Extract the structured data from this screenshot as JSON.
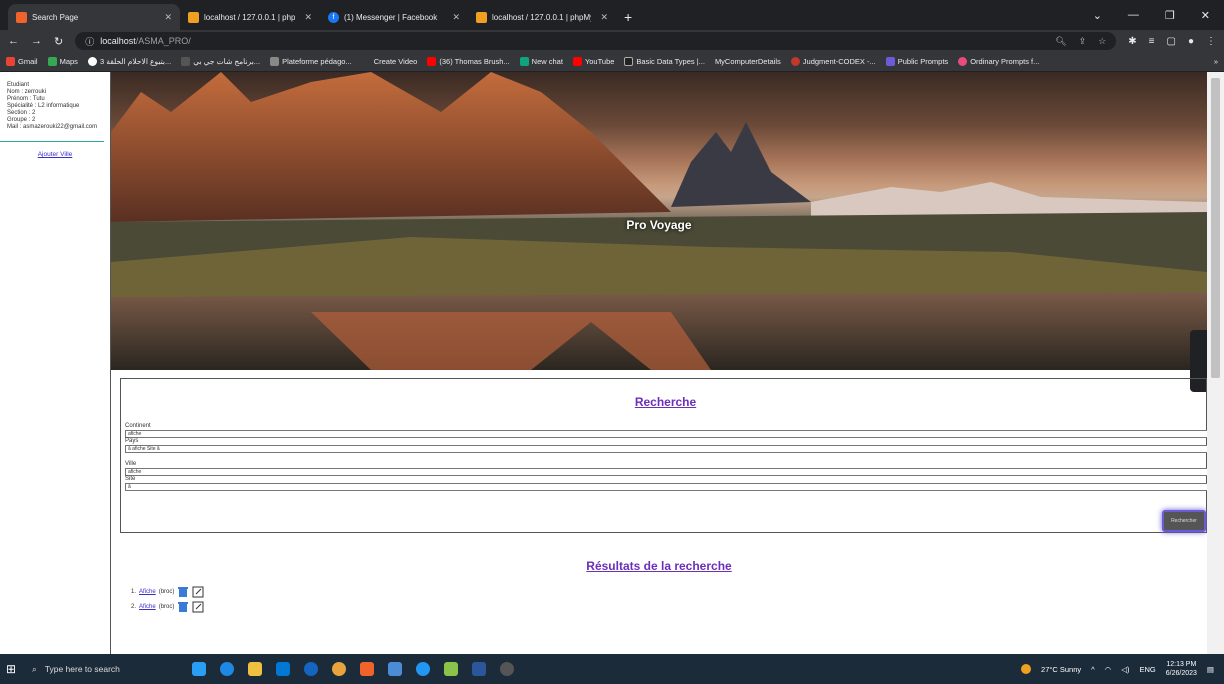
{
  "tabs": [
    {
      "title": "Search Page",
      "icon": "page-icon",
      "color": "#f0642c",
      "active": true
    },
    {
      "title": "localhost / 127.0.0.1 | phpMyAdm",
      "icon": "phpmyadmin-icon",
      "color": "#f0a020"
    },
    {
      "title": "(1) Messenger | Facebook",
      "icon": "facebook-icon",
      "color": "#1877f2"
    },
    {
      "title": "localhost / 127.0.0.1 | phpMyAdm",
      "icon": "phpmyadmin-icon",
      "color": "#f0a020"
    }
  ],
  "address": {
    "host": "localhost",
    "path": "/ASMA_PRO/"
  },
  "bookmarks": [
    "Gmail",
    "Maps",
    "بتبوع الاحلام الحلقة 3...",
    "برنامج شات جي بي...",
    "Plateforme pédago...",
    "Create Video",
    "(36) Thomas Brush...",
    "New chat",
    "YouTube",
    "Basic Data Types |...",
    "MyComputerDetails",
    "Judgment-CODEX -...",
    "Public Prompts",
    "Ordinary Prompts f..."
  ],
  "sidebar": {
    "lines": [
      "Etudiant",
      "Nom : zerrouki",
      "Prénom : Tutu",
      "Spécialité : L2 informatique",
      "Section : 2",
      "Groupe : 2",
      "Mail : asmazerouki22@gmail.com"
    ],
    "link": "Ajouter Ville"
  },
  "hero": {
    "title": "Pro Voyage"
  },
  "form": {
    "title": "Recherche",
    "continent_label": "Continent",
    "continent_value": "afiche",
    "pays_label": "Pays",
    "pays_value": "â afiche Site â",
    "ville_label": "Ville",
    "ville_value": "afiche",
    "site_label": "Site",
    "site_value": "â",
    "button": "Rechercher"
  },
  "results": {
    "title": "Résultats de la recherche",
    "items": [
      {
        "num": "1.",
        "name": "Afiche",
        "extra": "(broc)"
      },
      {
        "num": "2.",
        "name": "Afiche",
        "extra": "(broc)"
      }
    ]
  },
  "taskbar": {
    "search": "Type here to search",
    "weather": "27°C  Sunny",
    "lang": "ENG",
    "time": "12:13 PM",
    "date": "6/26/2023"
  }
}
